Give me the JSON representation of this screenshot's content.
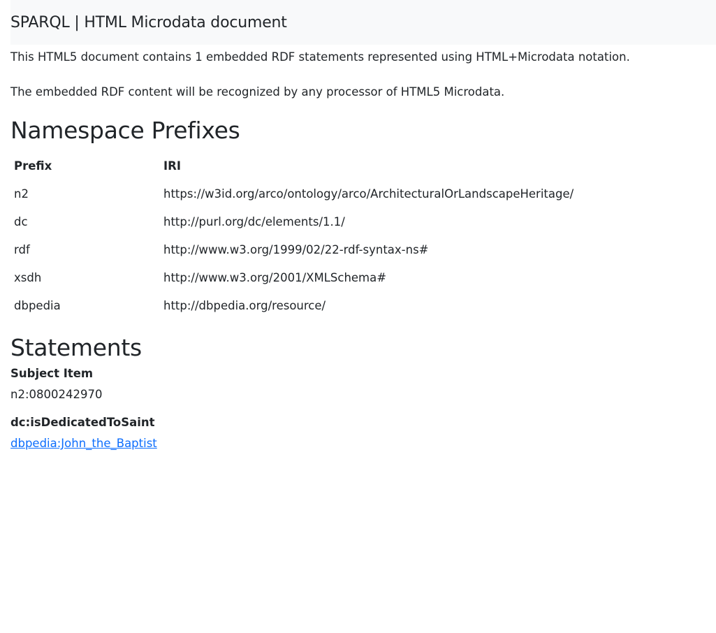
{
  "header": {
    "title": "SPARQL | HTML Microdata document"
  },
  "intro": {
    "line1": "This HTML5 document contains 1 embedded RDF statements represented using HTML+Microdata notation.",
    "line2": "The embedded RDF content will be recognized by any processor of HTML5 Microdata."
  },
  "namespaces": {
    "heading": "Namespace Prefixes",
    "columns": [
      "Prefix",
      "IRI"
    ],
    "rows": [
      {
        "prefix": "n2",
        "iri": "https://w3id.org/arco/ontology/arco/ArchitecturalOrLandscapeHeritage/"
      },
      {
        "prefix": "dc",
        "iri": "http://purl.org/dc/elements/1.1/"
      },
      {
        "prefix": "rdf",
        "iri": "http://www.w3.org/1999/02/22-rdf-syntax-ns#"
      },
      {
        "prefix": "xsdh",
        "iri": "http://www.w3.org/2001/XMLSchema#"
      },
      {
        "prefix": "dbpedia",
        "iri": "http://dbpedia.org/resource/"
      }
    ]
  },
  "statements": {
    "heading": "Statements",
    "subject_label": "Subject Item",
    "subject_value": "n2:0800242970",
    "predicate_label": "dc:isDedicatedToSaint",
    "object_link": "dbpedia:John_the_Baptist",
    "link_color": "#0d6efd"
  }
}
